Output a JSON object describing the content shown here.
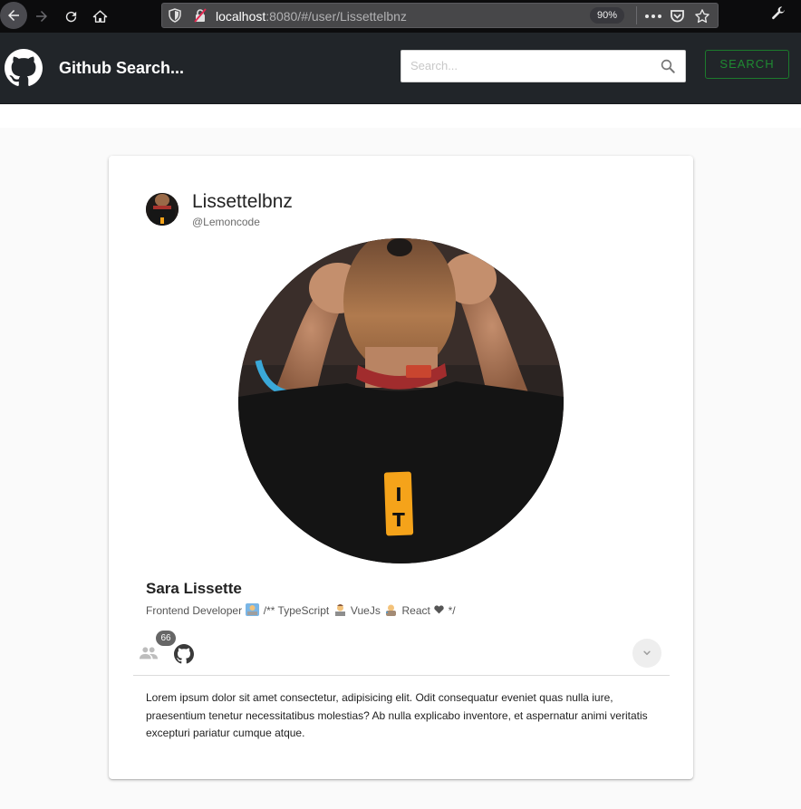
{
  "browser": {
    "url_host": "localhost",
    "url_rest": ":8080/#/user/Lissettelbnz",
    "zoom": "90%"
  },
  "app_bar": {
    "title": "Github Search...",
    "search_placeholder": "Search...",
    "search_button": "SEARCH",
    "accent_color": "#1f8a32"
  },
  "card": {
    "title": "Lissettelbnz",
    "subtitle": "@Lemoncode",
    "name": "Sara Lissette",
    "bio_parts": [
      "Frontend Developer",
      "/** TypeScript",
      "VueJs",
      "React",
      "*/"
    ],
    "bio_emojis": [
      "woman-technologist-emoji",
      "woman-technologist-emoji",
      "woman-artist-emoji",
      "heart-emoji"
    ],
    "followers_count": "66",
    "description": "Lorem ipsum dolor sit amet consectetur, adipisicing elit. Odit consequatur eveniet quas nulla iure, praesentium tenetur necessitatibus molestias? Ab nulla explicabo inventore, et aspernatur animi veritatis excepturi pariatur cumque atque.",
    "icons": [
      "people-icon",
      "github-icon",
      "expand-more-icon"
    ]
  }
}
